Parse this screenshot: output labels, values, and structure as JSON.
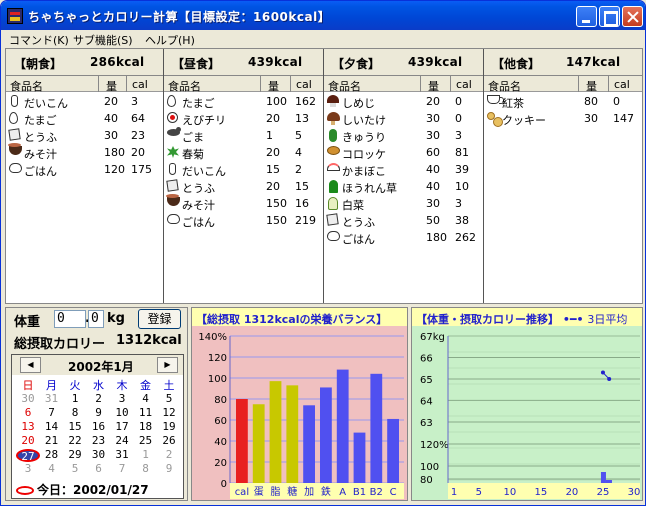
{
  "window": {
    "title": "ちゃちゃっとカロリー計算【目標設定：1600kcal】"
  },
  "menu": [
    {
      "label": "コマンド(K)"
    },
    {
      "label": "サブ機能(S)"
    },
    {
      "label": "ヘルプ(H)"
    }
  ],
  "columns": {
    "food": "食品名",
    "amount": "量",
    "cal": "cal"
  },
  "meals": [
    {
      "name": "【朝食】",
      "kcal": "286kcal",
      "items": [
        {
          "icon": "daikon",
          "name": "だいこん",
          "amount": "20",
          "cal": "3"
        },
        {
          "icon": "egg",
          "name": "たまご",
          "amount": "40",
          "cal": "64"
        },
        {
          "icon": "tofu",
          "name": "とうふ",
          "amount": "30",
          "cal": "23"
        },
        {
          "icon": "miso",
          "name": "みそ汁",
          "amount": "180",
          "cal": "20"
        },
        {
          "icon": "rice",
          "name": "ごはん",
          "amount": "120",
          "cal": "175"
        }
      ]
    },
    {
      "name": "【昼食】",
      "kcal": "439kcal",
      "items": [
        {
          "icon": "egg",
          "name": "たまご",
          "amount": "100",
          "cal": "162"
        },
        {
          "icon": "shrimp",
          "name": "えびチリ",
          "amount": "20",
          "cal": "13"
        },
        {
          "icon": "sesame",
          "name": "ごま",
          "amount": "1",
          "cal": "5"
        },
        {
          "icon": "shungiku",
          "name": "春菊",
          "amount": "20",
          "cal": "4"
        },
        {
          "icon": "daikon",
          "name": "だいこん",
          "amount": "15",
          "cal": "2"
        },
        {
          "icon": "tofu",
          "name": "とうふ",
          "amount": "20",
          "cal": "15"
        },
        {
          "icon": "miso",
          "name": "みそ汁",
          "amount": "150",
          "cal": "16"
        },
        {
          "icon": "rice",
          "name": "ごはん",
          "amount": "150",
          "cal": "219"
        }
      ]
    },
    {
      "name": "【夕食】",
      "kcal": "439kcal",
      "items": [
        {
          "icon": "shimeji",
          "name": "しめじ",
          "amount": "20",
          "cal": "0"
        },
        {
          "icon": "shiitake",
          "name": "しいたけ",
          "amount": "30",
          "cal": "0"
        },
        {
          "icon": "cucumber",
          "name": "きゅうり",
          "amount": "30",
          "cal": "3"
        },
        {
          "icon": "croquette",
          "name": "コロッケ",
          "amount": "60",
          "cal": "81"
        },
        {
          "icon": "kamaboko",
          "name": "かまぼこ",
          "amount": "40",
          "cal": "39"
        },
        {
          "icon": "spinach",
          "name": "ほうれん草",
          "amount": "40",
          "cal": "10"
        },
        {
          "icon": "hakusai",
          "name": "白菜",
          "amount": "30",
          "cal": "3"
        },
        {
          "icon": "tofu",
          "name": "とうふ",
          "amount": "50",
          "cal": "38"
        },
        {
          "icon": "rice",
          "name": "ごはん",
          "amount": "180",
          "cal": "262"
        }
      ]
    },
    {
      "name": "【他食】",
      "kcal": "147kcal",
      "items": [
        {
          "icon": "tea",
          "name": "紅茶",
          "amount": "80",
          "cal": "0"
        },
        {
          "icon": "cookie",
          "name": "クッキー",
          "amount": "30",
          "cal": "147"
        }
      ]
    }
  ],
  "weight": {
    "label": "体重",
    "int_value": "0",
    "dec_value": "0",
    "dot": ".",
    "unit": "kg",
    "register": "登録"
  },
  "total": {
    "label": "総摂取カロリー",
    "value": "1312kcal"
  },
  "calendar": {
    "month": "2002年1月",
    "prev": "◀",
    "next": "▶",
    "weekdays": [
      "日",
      "月",
      "火",
      "水",
      "木",
      "金",
      "土"
    ],
    "weeks": [
      [
        "30",
        "31",
        "1",
        "2",
        "3",
        "4",
        "5"
      ],
      [
        "6",
        "7",
        "8",
        "9",
        "10",
        "11",
        "12"
      ],
      [
        "13",
        "14",
        "15",
        "16",
        "17",
        "18",
        "19"
      ],
      [
        "20",
        "21",
        "22",
        "23",
        "24",
        "25",
        "26"
      ],
      [
        "27",
        "28",
        "29",
        "30",
        "31",
        "1",
        "2"
      ],
      [
        "3",
        "4",
        "5",
        "6",
        "7",
        "8",
        "9"
      ]
    ],
    "today_label": "今日：2002/01/27"
  },
  "balance_chart": {
    "title": "【総摂取 1312kcalの栄養バランス】",
    "chart_data": {
      "type": "bar",
      "categories": [
        "cal",
        "蛋",
        "脂",
        "糖",
        "加",
        "鉄",
        "A",
        "B1",
        "B2",
        "C"
      ],
      "values": [
        80,
        75,
        97,
        93,
        74,
        91,
        108,
        48,
        104,
        61
      ],
      "colors": [
        "#e82020",
        "#c8c800",
        "#c8c800",
        "#c8c800",
        "#5050f0",
        "#5050f0",
        "#5050f0",
        "#5050f0",
        "#5050f0",
        "#5050f0"
      ],
      "yticks": [
        "140%",
        "120",
        "100",
        "80",
        "60",
        "40",
        "20",
        "0"
      ],
      "ylim": [
        0,
        140
      ]
    }
  },
  "trend_chart": {
    "title": "【体重・摂取カロリー推移】",
    "legend": "3日平均",
    "chart_data": {
      "type": "line",
      "x_ticks": [
        "1",
        "5",
        "10",
        "15",
        "20",
        "25",
        "30"
      ],
      "weight_ticks": [
        "67kg",
        "66",
        "65",
        "64",
        "63"
      ],
      "cal_ticks": [
        "120%",
        "100",
        "80"
      ],
      "weight_points": [
        [
          25,
          65.3
        ],
        [
          26,
          65.0
        ]
      ],
      "cal_bars": [
        [
          25,
          90
        ]
      ]
    }
  }
}
